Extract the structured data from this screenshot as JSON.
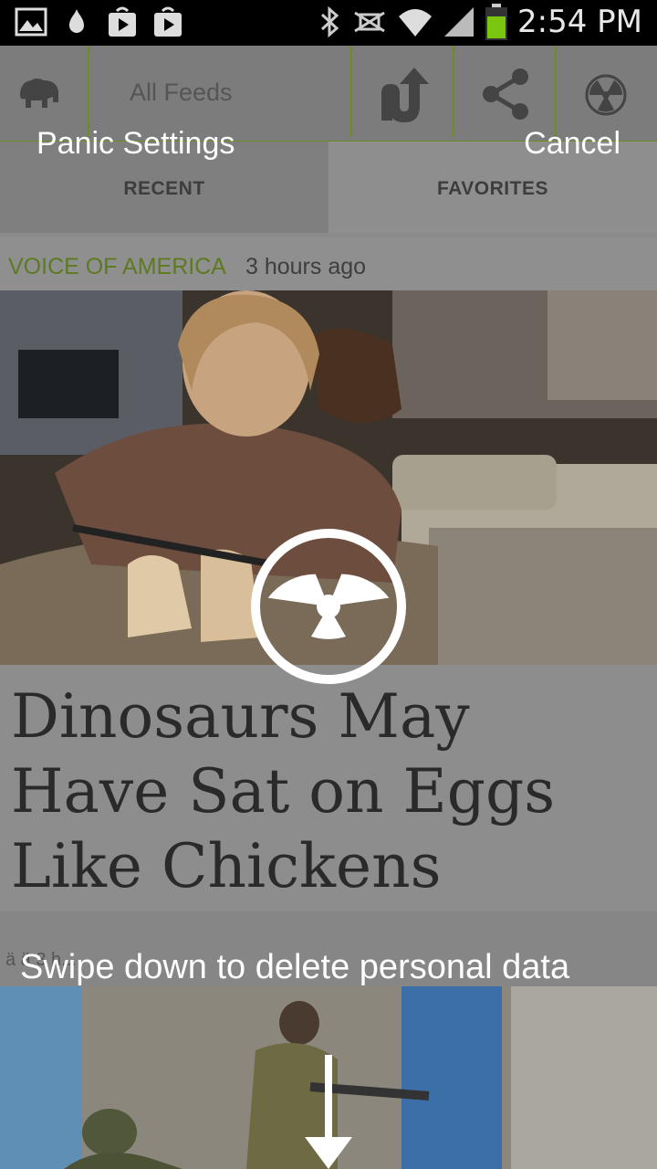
{
  "status_bar": {
    "time": "2:54 PM",
    "icons": [
      "gallery-icon",
      "drop-icon",
      "play-store-icon",
      "store-bag-icon",
      "bluetooth-icon",
      "nfc-icon",
      "wifi-icon",
      "signal-icon",
      "battery-icon"
    ]
  },
  "appbar": {
    "feeds_label": "All Feeds",
    "icons": [
      "bison-logo-icon",
      "arrow-up-icon",
      "share-icon",
      "panic-icon"
    ],
    "accent_color": "#6a8e20"
  },
  "tabs": [
    "RECENT",
    "FAVORITES"
  ],
  "overlay": {
    "title": "Panic Settings",
    "cancel": "Cancel",
    "swipe_hint": "Swipe down to delete personal data"
  },
  "article1": {
    "source": "VOICE OF AMERICA",
    "ago": "3 hours ago",
    "headline": "Dinosaurs May Have Sat on Eggs Like Chickens"
  },
  "article2": {
    "meta": "ä ä 3 h..."
  }
}
